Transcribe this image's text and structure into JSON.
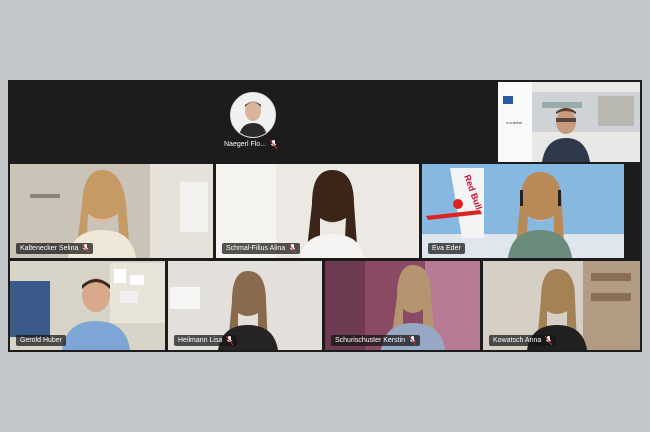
{
  "participants": {
    "top_center": {
      "name": "Naegerl Flo..."
    },
    "top_right": {
      "name": "",
      "sign_text": "m.a.dreher"
    },
    "row1": [
      {
        "name": "Kaltenecker Selina"
      },
      {
        "name": "Schmal-Filius Alina"
      },
      {
        "name": "Eva Eder",
        "banner_text": "Red Bull"
      }
    ],
    "row2": [
      {
        "name": "Gerold Huber"
      },
      {
        "name": "Heilmann Lisa"
      },
      {
        "name": "Schurischuster Kerstin"
      },
      {
        "name": "Kowatsch Anna"
      }
    ]
  },
  "colors": {
    "background": "#c3c6c9",
    "meeting_bg": "#1c1c1c",
    "active_speaker_border": "#7b8ee8"
  },
  "icons": {
    "muted_mic": "mic-muted-icon"
  }
}
